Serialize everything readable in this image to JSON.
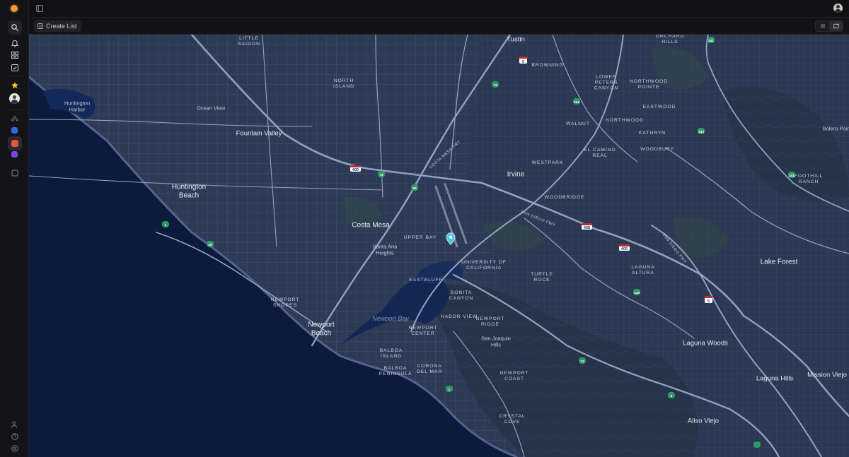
{
  "toolbar": {
    "create_list_label": "Create List"
  },
  "map": {
    "cities": [
      "Tustin",
      "Fountain Valley",
      "Huntington Beach",
      "Costa Mesa",
      "Irvine",
      "Newport Beach",
      "Lake Forest",
      "Laguna Woods",
      "Laguna Hills",
      "Mission Viejo",
      "Aliso Viejo"
    ],
    "neighborhoods": [
      "LITTLE SAIGON",
      "NORTH ISLAND",
      "BROWNING",
      "LOWER PETERS CANYON",
      "NORTHWOOD POINTE",
      "ORCHARD HILLS",
      "EASTWOOD",
      "WALNUT",
      "NORTHWOOD",
      "KATHRYN",
      "WOODBURY",
      "EL CAMINO REAL",
      "WESTPARK",
      "WOODBRIDGE",
      "FOOTHILL RANCH",
      "UPPER BAY",
      "UNIVERSITY OF CALIFORNIA",
      "TURTLE ROCK",
      "EASTBLUFF",
      "BONITA CANYON",
      "LAGUNA ALTURA",
      "NEWPORT SHORES",
      "HABOR VIEW",
      "NEWPORT RIDGE",
      "NEWPORT CENTER",
      "BALBOA ISLAND",
      "BALBOA PENINSULA",
      "CORONA DEL MAR",
      "NEWPORT COAST",
      "CRYSTAL COVE"
    ],
    "places": [
      "Huntington Harbor",
      "Ocean View",
      "Santa Ana Heights",
      "San Joaquin Hills",
      "Bolero Point"
    ],
    "water": [
      "Newport Bay"
    ],
    "roads": [
      "COSTA MESA FWY",
      "SAN DIEGO FWY",
      "SAN DIEGO FWY"
    ],
    "shields": [
      "405",
      "405",
      "405",
      "5",
      "5",
      "73",
      "55",
      "1",
      "1",
      "39",
      "261",
      "133",
      "133",
      "241",
      "241",
      "73",
      "73",
      "5"
    ]
  }
}
